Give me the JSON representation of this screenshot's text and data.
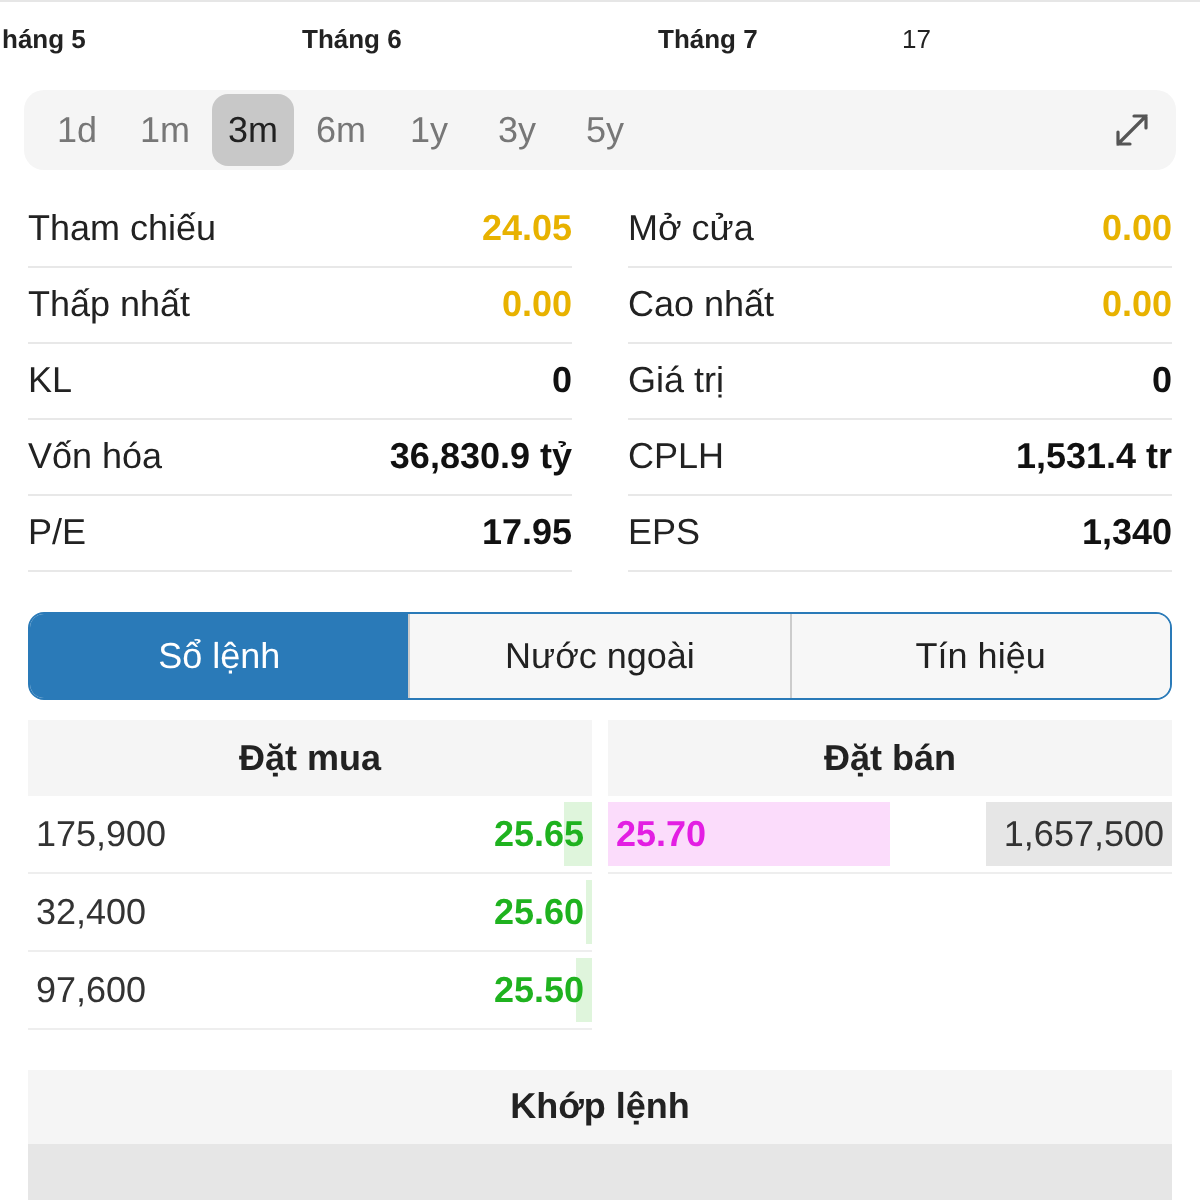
{
  "chart_axis": {
    "labels": [
      "háng 5",
      "Tháng 6",
      "Tháng 7",
      "17"
    ]
  },
  "ranges": [
    {
      "label": "1d",
      "selected": false
    },
    {
      "label": "1m",
      "selected": false
    },
    {
      "label": "3m",
      "selected": true
    },
    {
      "label": "6m",
      "selected": false
    },
    {
      "label": "1y",
      "selected": false
    },
    {
      "label": "3y",
      "selected": false
    },
    {
      "label": "5y",
      "selected": false
    }
  ],
  "stats": [
    {
      "label": "Tham chiếu",
      "value": "24.05",
      "color": "#e8b200"
    },
    {
      "label": "Mở cửa",
      "value": "0.00",
      "color": "#e8b200"
    },
    {
      "label": "Thấp nhất",
      "value": "0.00",
      "color": "#e8b200"
    },
    {
      "label": "Cao nhất",
      "value": "0.00",
      "color": "#e8b200"
    },
    {
      "label": "KL",
      "value": "0",
      "color": "#111111"
    },
    {
      "label": "Giá trị",
      "value": "0",
      "color": "#111111"
    },
    {
      "label": "Vốn hóa",
      "value": "36,830.9 tỷ",
      "color": "#111111"
    },
    {
      "label": "CPLH",
      "value": "1,531.4 tr",
      "color": "#111111"
    },
    {
      "label": "P/E",
      "value": "17.95",
      "color": "#111111"
    },
    {
      "label": "EPS",
      "value": "1,340",
      "color": "#111111"
    }
  ],
  "tabs": [
    {
      "label": "Sổ lệnh",
      "selected": true
    },
    {
      "label": "Nước ngoài",
      "selected": false
    },
    {
      "label": "Tín hiệu",
      "selected": false
    }
  ],
  "order_book": {
    "bid_title": "Đặt mua",
    "ask_title": "Đặt bán",
    "bids": [
      {
        "volume": "175,900",
        "price": "25.65",
        "level": 0.05
      },
      {
        "volume": "32,400",
        "price": "25.60",
        "level": 0.01
      },
      {
        "volume": "97,600",
        "price": "25.50",
        "level": 0.03
      }
    ],
    "asks": [
      {
        "price": {
          "text": "25.70",
          "level": 0.5
        },
        "volume": {
          "text": "1,657,500",
          "level": 0.33
        }
      }
    ]
  },
  "matched": {
    "title": "Khớp lệnh"
  }
}
